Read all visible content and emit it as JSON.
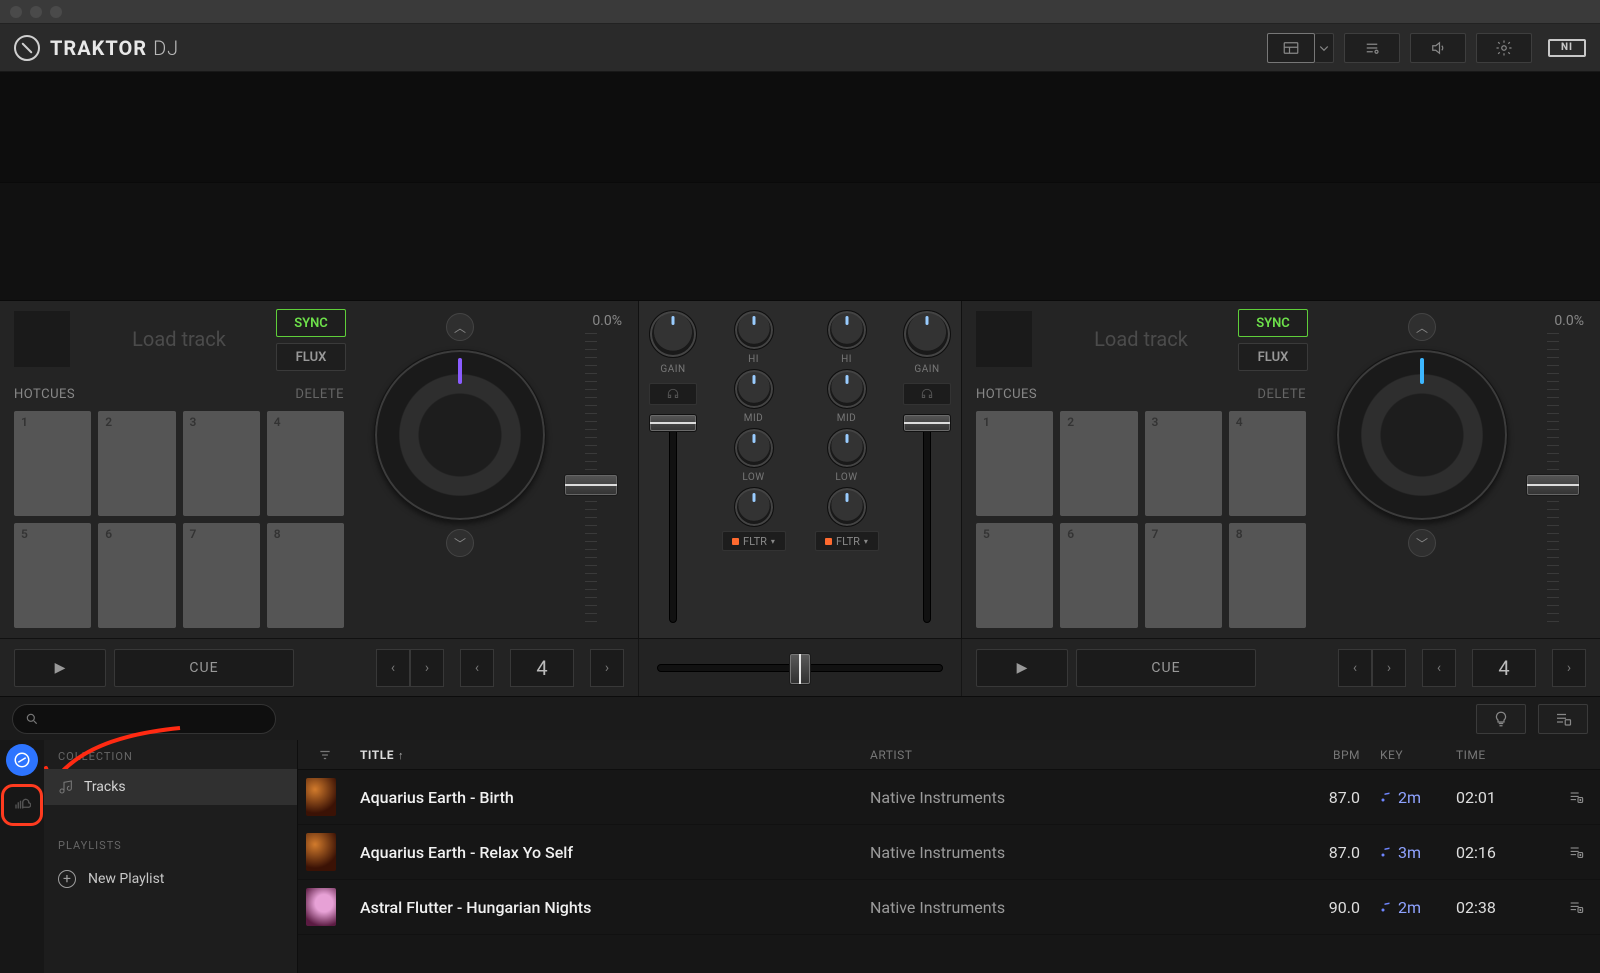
{
  "app": {
    "brand": "TRAKTOR",
    "sub": "DJ"
  },
  "deck": {
    "load_label": "Load track",
    "sync": "SYNC",
    "flux": "FLUX",
    "hotcues": "HOTCUES",
    "delete": "DELETE",
    "tempo_pct": "0.0%",
    "cue": "CUE",
    "beat_value": "4",
    "pad_labels": [
      "1",
      "2",
      "3",
      "4",
      "5",
      "6",
      "7",
      "8"
    ]
  },
  "mixer": {
    "gain": "GAIN",
    "hi": "HI",
    "mid": "MID",
    "low": "LOW",
    "fltr": "FLTR"
  },
  "browser": {
    "collection_header": "COLLECTION",
    "playlists_header": "PLAYLISTS",
    "tracks_label": "Tracks",
    "new_playlist": "New Playlist",
    "columns": {
      "title": "TITLE",
      "artist": "ARTIST",
      "bpm": "BPM",
      "key": "KEY",
      "time": "TIME"
    },
    "rows": [
      {
        "title": "Aquarius Earth - Birth",
        "artist": "Native Instruments",
        "bpm": "87.0",
        "key": "2m",
        "time": "02:01",
        "art": "a"
      },
      {
        "title": "Aquarius Earth - Relax Yo Self",
        "artist": "Native Instruments",
        "bpm": "87.0",
        "key": "3m",
        "time": "02:16",
        "art": "a"
      },
      {
        "title": "Astral Flutter - Hungarian Nights",
        "artist": "Native Instruments",
        "bpm": "90.0",
        "key": "2m",
        "time": "02:38",
        "art": "b"
      }
    ]
  }
}
